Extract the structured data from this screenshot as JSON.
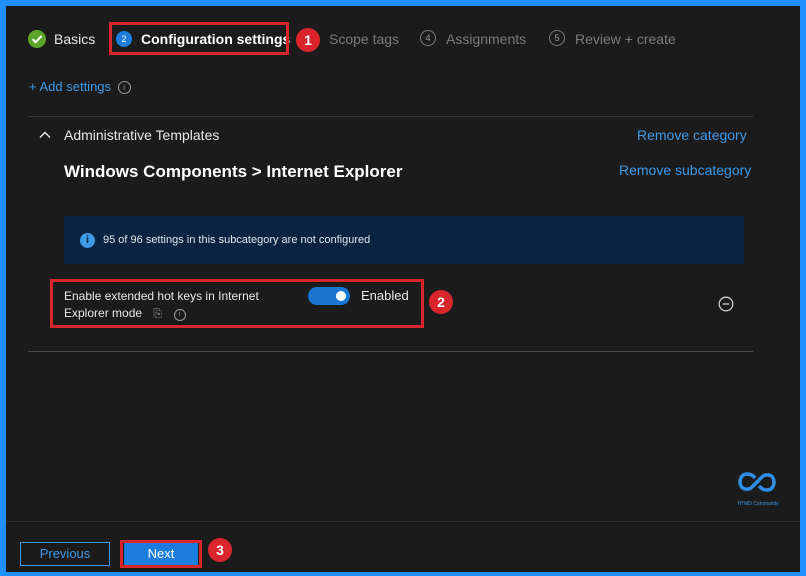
{
  "wizard": {
    "steps": [
      {
        "label": "Basics",
        "number": "",
        "state": "done"
      },
      {
        "label": "Configuration settings",
        "number": "2",
        "state": "current"
      },
      {
        "label": "Scope tags",
        "number": "3",
        "state": "future"
      },
      {
        "label": "Assignments",
        "number": "4",
        "state": "future"
      },
      {
        "label": "Review + create",
        "number": "5",
        "state": "future"
      }
    ]
  },
  "add_settings_label": "+ Add settings",
  "category": {
    "title": "Administrative Templates",
    "remove_category": "Remove category",
    "subcategory_title": "Windows Components > Internet Explorer",
    "remove_subcategory": "Remove subcategory"
  },
  "info_banner": {
    "text": "95 of 96 settings in this subcategory are not configured"
  },
  "setting": {
    "label_line1": "Enable extended hot keys in Internet",
    "label_line2": "Explorer mode",
    "value": "Enabled",
    "toggle_on": true
  },
  "annotations": [
    "1",
    "2",
    "3"
  ],
  "footer": {
    "previous_label": "Previous",
    "next_label": "Next"
  },
  "watermark": {
    "logo_text": "HTMD Community"
  },
  "colors": {
    "accent": "#1d7ddf",
    "link": "#3f9ae8",
    "annotation_red": "#d9262c",
    "success_green": "#5ca52b",
    "frame_blue": "#1e90ff"
  }
}
